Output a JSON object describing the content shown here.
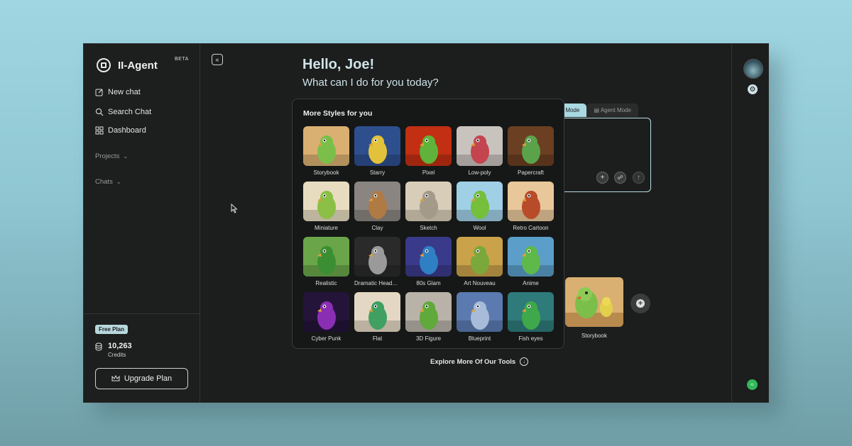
{
  "app": {
    "name": "II-Agent",
    "badge": "BETA"
  },
  "sidebar": {
    "new_chat": "New chat",
    "search_chat": "Search Chat",
    "dashboard": "Dashboard",
    "projects": "Projects",
    "chats": "Chats",
    "plan_badge": "Free Plan",
    "credits_value": "10,263",
    "credits_label": "Credits",
    "upgrade": "Upgrade Plan"
  },
  "main": {
    "greeting": "Hello, Joe!",
    "subtitle": "What can I do for you today?",
    "mode_tabs": [
      {
        "label": "t Mode",
        "active": true
      },
      {
        "label": "Agent Mode",
        "active": false
      }
    ],
    "explore": "Explore More Of Our Tools",
    "selected_style": "Storybook"
  },
  "styles_popover": {
    "title": "More Styles for you",
    "styles": [
      {
        "label": "Storybook",
        "bg": "#d9b071",
        "bird": "#7bbf4a"
      },
      {
        "label": "Starry",
        "bg": "#2d4f8e",
        "bird": "#e2c23a"
      },
      {
        "label": "Pixel",
        "bg": "#c22f12",
        "bird": "#5fb33a"
      },
      {
        "label": "Low-poly",
        "bg": "#c9c3be",
        "bird": "#c4454f"
      },
      {
        "label": "Papercraft",
        "bg": "#6b3f22",
        "bird": "#5aa34a"
      },
      {
        "label": "Miniature",
        "bg": "#e7dcc0",
        "bird": "#8bbf46"
      },
      {
        "label": "Clay",
        "bg": "#8a8580",
        "bird": "#b07a45"
      },
      {
        "label": "Sketch",
        "bg": "#d8cdb8",
        "bird": "#a39a8a"
      },
      {
        "label": "Wool",
        "bg": "#9fd0e6",
        "bird": "#74bf3c"
      },
      {
        "label": "Retro Cartoon",
        "bg": "#e8c89a",
        "bird": "#b84b2a"
      },
      {
        "label": "Realistic",
        "bg": "#6aa54a",
        "bird": "#3b8f32"
      },
      {
        "label": "Dramatic Headshot",
        "bg": "#2a2a2a",
        "bird": "#9a9a9a"
      },
      {
        "label": "80s Glam",
        "bg": "#3a3a8a",
        "bird": "#2f7fc4"
      },
      {
        "label": "Art Nouveau",
        "bg": "#c9a24a",
        "bird": "#7aa83a"
      },
      {
        "label": "Anime",
        "bg": "#5a9ec9",
        "bird": "#5fb84a"
      },
      {
        "label": "Cyber Punk",
        "bg": "#24143a",
        "bird": "#8a2fb4"
      },
      {
        "label": "Flat",
        "bg": "#e4d8c4",
        "bird": "#3fa062"
      },
      {
        "label": "3D Figure",
        "bg": "#b9b2a8",
        "bird": "#5faa3a"
      },
      {
        "label": "Blueprint",
        "bg": "#5a7ab0",
        "bird": "#a8bbd8"
      },
      {
        "label": "Fish eyes",
        "bg": "#2f7a7a",
        "bird": "#3fa84a"
      }
    ]
  }
}
